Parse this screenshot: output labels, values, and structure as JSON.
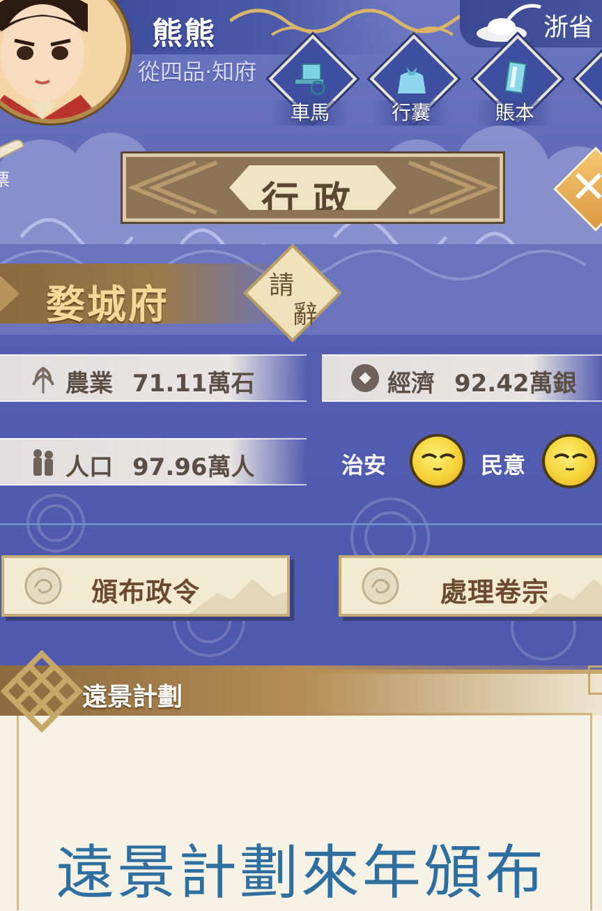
{
  "player": {
    "name": "熊熊",
    "rank": "從四品·知府"
  },
  "province": {
    "label": "浙省",
    "icon": "ink-stone-icon"
  },
  "nav": [
    {
      "label": "車馬",
      "icon": "carriage-icon"
    },
    {
      "label": "行囊",
      "icon": "bundle-icon"
    },
    {
      "label": "賬本",
      "icon": "ledger-icon"
    }
  ],
  "side": {
    "scroll_label": "票"
  },
  "title": "行政",
  "city": {
    "name": "婺城府",
    "resign_1": "請",
    "resign_2": "辭"
  },
  "stats": {
    "agri": {
      "label": "農業",
      "value": "71.11萬石",
      "icon": "wheat-icon"
    },
    "econ": {
      "label": "經濟",
      "value": "92.42萬銀",
      "icon": "coin-icon"
    },
    "pop": {
      "label": "人口",
      "value": "97.96萬人",
      "icon": "people-icon"
    }
  },
  "moods": {
    "order_label": "治安",
    "people_label": "民意"
  },
  "actions": {
    "decree": "頒布政令",
    "cases": "處理卷宗"
  },
  "plan": {
    "title": "遠景計劃",
    "message": "遠景計劃來年頒布"
  },
  "colors": {
    "bg": "#5660b2",
    "gold": "#b48d55",
    "paper": "#f3ead2",
    "accent_blue": "#2f6f9f"
  }
}
